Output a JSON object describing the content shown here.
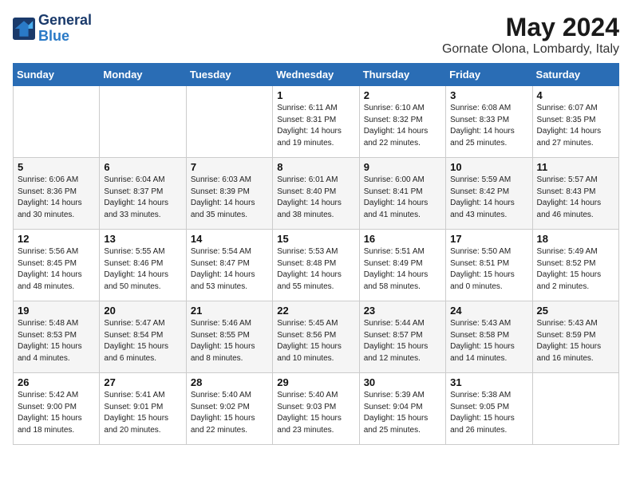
{
  "logo": {
    "line1": "General",
    "line2": "Blue"
  },
  "title": "May 2024",
  "subtitle": "Gornate Olona, Lombardy, Italy",
  "headers": [
    "Sunday",
    "Monday",
    "Tuesday",
    "Wednesday",
    "Thursday",
    "Friday",
    "Saturday"
  ],
  "weeks": [
    [
      {
        "day": "",
        "info": ""
      },
      {
        "day": "",
        "info": ""
      },
      {
        "day": "",
        "info": ""
      },
      {
        "day": "1",
        "info": "Sunrise: 6:11 AM\nSunset: 8:31 PM\nDaylight: 14 hours\nand 19 minutes."
      },
      {
        "day": "2",
        "info": "Sunrise: 6:10 AM\nSunset: 8:32 PM\nDaylight: 14 hours\nand 22 minutes."
      },
      {
        "day": "3",
        "info": "Sunrise: 6:08 AM\nSunset: 8:33 PM\nDaylight: 14 hours\nand 25 minutes."
      },
      {
        "day": "4",
        "info": "Sunrise: 6:07 AM\nSunset: 8:35 PM\nDaylight: 14 hours\nand 27 minutes."
      }
    ],
    [
      {
        "day": "5",
        "info": "Sunrise: 6:06 AM\nSunset: 8:36 PM\nDaylight: 14 hours\nand 30 minutes."
      },
      {
        "day": "6",
        "info": "Sunrise: 6:04 AM\nSunset: 8:37 PM\nDaylight: 14 hours\nand 33 minutes."
      },
      {
        "day": "7",
        "info": "Sunrise: 6:03 AM\nSunset: 8:39 PM\nDaylight: 14 hours\nand 35 minutes."
      },
      {
        "day": "8",
        "info": "Sunrise: 6:01 AM\nSunset: 8:40 PM\nDaylight: 14 hours\nand 38 minutes."
      },
      {
        "day": "9",
        "info": "Sunrise: 6:00 AM\nSunset: 8:41 PM\nDaylight: 14 hours\nand 41 minutes."
      },
      {
        "day": "10",
        "info": "Sunrise: 5:59 AM\nSunset: 8:42 PM\nDaylight: 14 hours\nand 43 minutes."
      },
      {
        "day": "11",
        "info": "Sunrise: 5:57 AM\nSunset: 8:43 PM\nDaylight: 14 hours\nand 46 minutes."
      }
    ],
    [
      {
        "day": "12",
        "info": "Sunrise: 5:56 AM\nSunset: 8:45 PM\nDaylight: 14 hours\nand 48 minutes."
      },
      {
        "day": "13",
        "info": "Sunrise: 5:55 AM\nSunset: 8:46 PM\nDaylight: 14 hours\nand 50 minutes."
      },
      {
        "day": "14",
        "info": "Sunrise: 5:54 AM\nSunset: 8:47 PM\nDaylight: 14 hours\nand 53 minutes."
      },
      {
        "day": "15",
        "info": "Sunrise: 5:53 AM\nSunset: 8:48 PM\nDaylight: 14 hours\nand 55 minutes."
      },
      {
        "day": "16",
        "info": "Sunrise: 5:51 AM\nSunset: 8:49 PM\nDaylight: 14 hours\nand 58 minutes."
      },
      {
        "day": "17",
        "info": "Sunrise: 5:50 AM\nSunset: 8:51 PM\nDaylight: 15 hours\nand 0 minutes."
      },
      {
        "day": "18",
        "info": "Sunrise: 5:49 AM\nSunset: 8:52 PM\nDaylight: 15 hours\nand 2 minutes."
      }
    ],
    [
      {
        "day": "19",
        "info": "Sunrise: 5:48 AM\nSunset: 8:53 PM\nDaylight: 15 hours\nand 4 minutes."
      },
      {
        "day": "20",
        "info": "Sunrise: 5:47 AM\nSunset: 8:54 PM\nDaylight: 15 hours\nand 6 minutes."
      },
      {
        "day": "21",
        "info": "Sunrise: 5:46 AM\nSunset: 8:55 PM\nDaylight: 15 hours\nand 8 minutes."
      },
      {
        "day": "22",
        "info": "Sunrise: 5:45 AM\nSunset: 8:56 PM\nDaylight: 15 hours\nand 10 minutes."
      },
      {
        "day": "23",
        "info": "Sunrise: 5:44 AM\nSunset: 8:57 PM\nDaylight: 15 hours\nand 12 minutes."
      },
      {
        "day": "24",
        "info": "Sunrise: 5:43 AM\nSunset: 8:58 PM\nDaylight: 15 hours\nand 14 minutes."
      },
      {
        "day": "25",
        "info": "Sunrise: 5:43 AM\nSunset: 8:59 PM\nDaylight: 15 hours\nand 16 minutes."
      }
    ],
    [
      {
        "day": "26",
        "info": "Sunrise: 5:42 AM\nSunset: 9:00 PM\nDaylight: 15 hours\nand 18 minutes."
      },
      {
        "day": "27",
        "info": "Sunrise: 5:41 AM\nSunset: 9:01 PM\nDaylight: 15 hours\nand 20 minutes."
      },
      {
        "day": "28",
        "info": "Sunrise: 5:40 AM\nSunset: 9:02 PM\nDaylight: 15 hours\nand 22 minutes."
      },
      {
        "day": "29",
        "info": "Sunrise: 5:40 AM\nSunset: 9:03 PM\nDaylight: 15 hours\nand 23 minutes."
      },
      {
        "day": "30",
        "info": "Sunrise: 5:39 AM\nSunset: 9:04 PM\nDaylight: 15 hours\nand 25 minutes."
      },
      {
        "day": "31",
        "info": "Sunrise: 5:38 AM\nSunset: 9:05 PM\nDaylight: 15 hours\nand 26 minutes."
      },
      {
        "day": "",
        "info": ""
      }
    ]
  ]
}
